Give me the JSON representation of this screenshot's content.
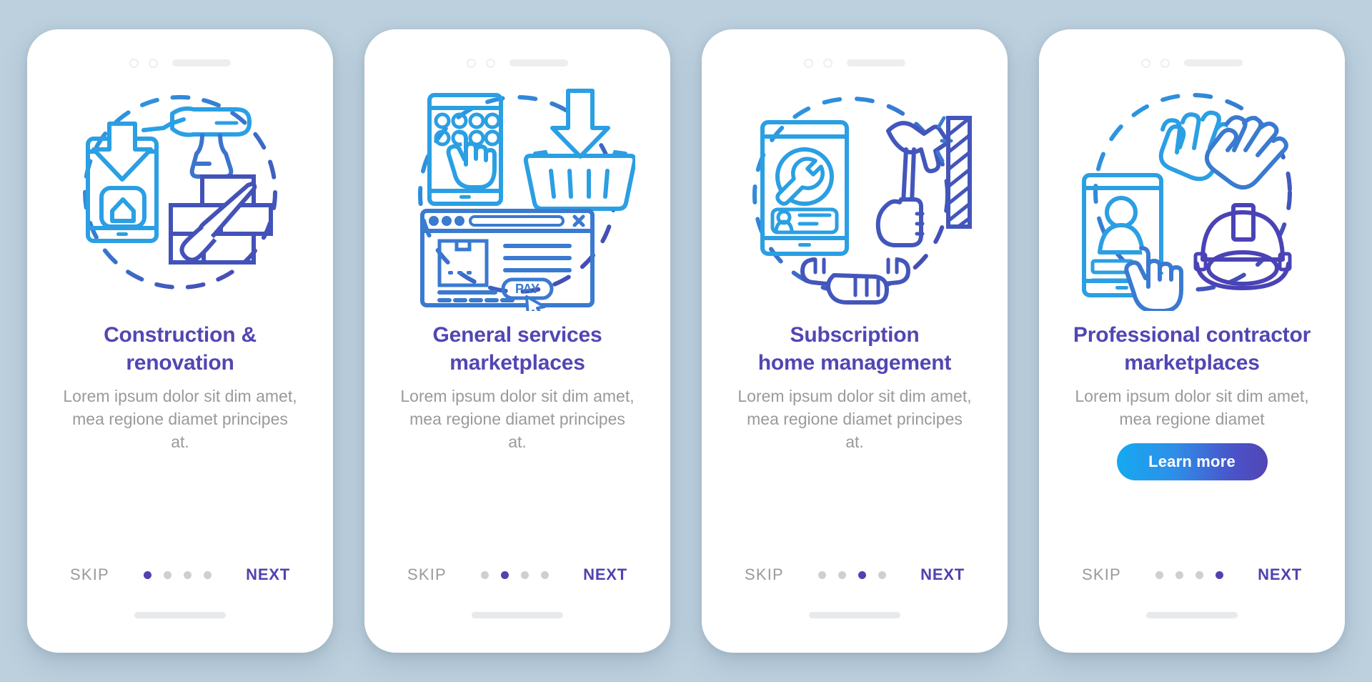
{
  "background_color": "#bcd0de",
  "theme": {
    "title_color": "#5246b4",
    "subtitle_color": "#9a9a9c",
    "next_color": "#4f43b0",
    "skip_color": "#9a9a9c",
    "dot_active_color": "#4f43b0",
    "dot_inactive_color": "#cfcfd2",
    "button_gradient_start": "#15a9f0",
    "button_gradient_end": "#5246b4"
  },
  "screens": [
    {
      "id": "construction-renovation",
      "title": "Construction & renovation",
      "title_line1": "Construction &",
      "title_line2": "renovation",
      "subtitle": "Lorem ipsum dolor sit dim amet, mea regione diamet principes at.",
      "illustration": "phone-download-drill-bricks-icon",
      "skip_label": "SKIP",
      "next_label": "NEXT",
      "dot_count": 4,
      "active_dot": 1,
      "has_learn_more": false,
      "learn_more_label": ""
    },
    {
      "id": "general-services-marketplaces",
      "title": "General services marketplaces",
      "title_line1": "General services",
      "title_line2": "marketplaces",
      "subtitle": "Lorem ipsum dolor sit dim amet, mea regione diamet principes at.",
      "illustration": "phone-tap-basket-browser-pay-icon",
      "browser_pay_label": "PAY",
      "skip_label": "SKIP",
      "next_label": "NEXT",
      "dot_count": 4,
      "active_dot": 2,
      "has_learn_more": false,
      "learn_more_label": ""
    },
    {
      "id": "subscription-home-management",
      "title": "Subscription home management",
      "title_line1": "Subscription",
      "title_line2": "home management",
      "subtitle": "Lorem ipsum dolor sit dim amet, mea regione diamet principes at.",
      "illustration": "phone-wrench-profile-hammer-wall-icon",
      "skip_label": "SKIP",
      "next_label": "NEXT",
      "dot_count": 4,
      "active_dot": 3,
      "has_learn_more": false,
      "learn_more_label": ""
    },
    {
      "id": "professional-contractor-marketplaces",
      "title": "Professional contractor marketplaces",
      "title_line1": "Professional contractor",
      "title_line2": "marketplaces",
      "subtitle": "Lorem ipsum dolor sit dim amet, mea regione diamet",
      "illustration": "phone-profile-gloves-hardhat-cursor-icon",
      "skip_label": "SKIP",
      "next_label": "NEXT",
      "dot_count": 4,
      "active_dot": 4,
      "has_learn_more": true,
      "learn_more_label": "Learn more"
    }
  ]
}
